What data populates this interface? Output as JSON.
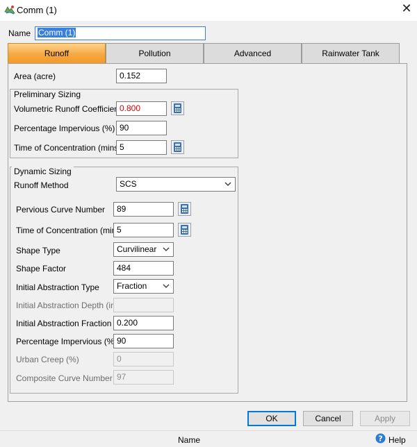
{
  "window": {
    "title": "Comm (1)",
    "app_icon": "subcatchment-icon",
    "close_icon": "close-icon"
  },
  "name_field": {
    "label": "Name",
    "value": "Comm (1)"
  },
  "tabs": [
    {
      "label": "Runoff"
    },
    {
      "label": "Pollution"
    },
    {
      "label": "Advanced"
    },
    {
      "label": "Rainwater Tank"
    }
  ],
  "area": {
    "label": "Area (acre)",
    "value": "0.152"
  },
  "preliminary_sizing": {
    "legend": "Preliminary Sizing",
    "runoff_coefficient": {
      "label": "Volumetric Runoff Coefficient",
      "value": "0.800",
      "value_color": "#e00000"
    },
    "percent_impervious": {
      "label": "Percentage Impervious (%)",
      "value": "90"
    },
    "time_of_concentration": {
      "label": "Time of Concentration (mins)",
      "value": "5"
    }
  },
  "dynamic_sizing": {
    "legend": "Dynamic Sizing",
    "runoff_method": {
      "label": "Runoff Method",
      "value": "SCS"
    },
    "pervious_curve_number": {
      "label": "Pervious Curve Number",
      "value": "89"
    },
    "time_of_concentration": {
      "label": "Time of Concentration (mins)",
      "value": "5"
    },
    "shape_type": {
      "label": "Shape Type",
      "value": "Curvilinear"
    },
    "shape_factor": {
      "label": "Shape Factor",
      "value": "484"
    },
    "initial_abstraction_type": {
      "label": "Initial Abstraction Type",
      "value": "Fraction"
    },
    "initial_abstraction_depth": {
      "label": "Initial Abstraction Depth (in)",
      "value": ""
    },
    "initial_abstraction_fraction": {
      "label": "Initial Abstraction Fraction",
      "value": "0.200"
    },
    "percent_impervious": {
      "label": "Percentage Impervious (%)",
      "value": "90"
    },
    "urban_creep": {
      "label": "Urban Creep (%)",
      "value": "0"
    },
    "composite_curve_number": {
      "label": "Composite Curve Number",
      "value": "97"
    }
  },
  "buttons": {
    "ok": "OK",
    "cancel": "Cancel",
    "apply": "Apply"
  },
  "status_bar": {
    "field_name": "Name",
    "help": "Help",
    "help_icon": "help-icon"
  },
  "colors": {
    "accent_tab": "#f6a841",
    "error_value": "#e00000",
    "window_bg": "#f0f0f0"
  }
}
